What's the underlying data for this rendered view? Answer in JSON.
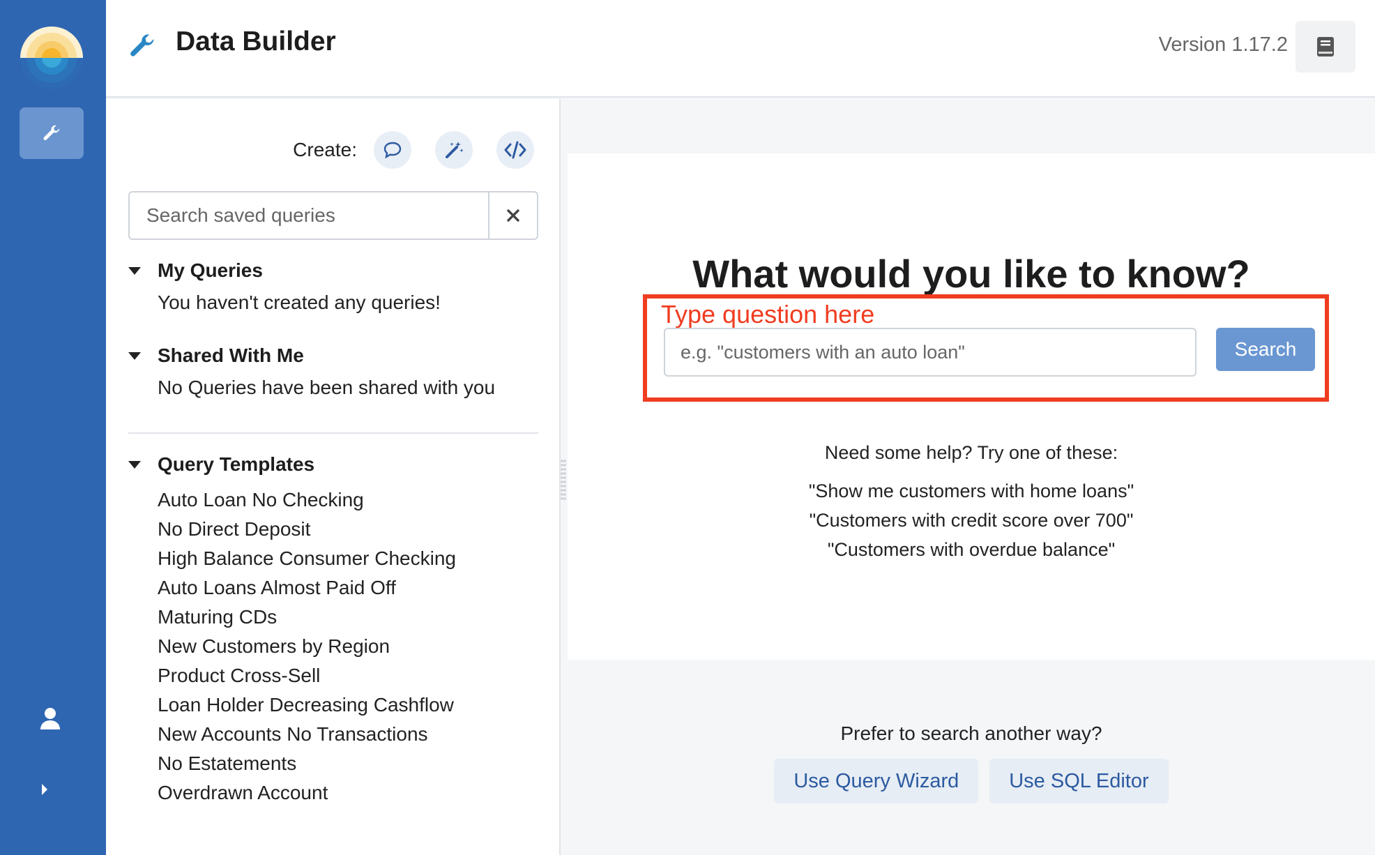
{
  "header": {
    "title": "Data Builder",
    "version": "Version 1.17.2"
  },
  "sidebar": {
    "create_label": "Create:",
    "search_placeholder": "Search saved queries",
    "my_queries": {
      "title": "My Queries",
      "empty": "You haven't created any queries!"
    },
    "shared": {
      "title": "Shared With Me",
      "empty": "No Queries have been shared with you"
    },
    "templates": {
      "title": "Query Templates",
      "items": [
        "Auto Loan No Checking",
        "No Direct Deposit",
        "High Balance Consumer Checking",
        "Auto Loans Almost Paid Off",
        "Maturing CDs",
        "New Customers by Region",
        "Product Cross-Sell",
        "Loan Holder Decreasing Cashflow",
        "New Accounts No Transactions",
        "No Estatements",
        "Overdrawn Account"
      ]
    }
  },
  "main": {
    "ask_title": "What would you like to know?",
    "type_hint": "Type question here",
    "question_placeholder": "e.g. \"customers with an auto loan\"",
    "search_label": "Search",
    "help_head": "Need some help? Try one of these:",
    "examples": [
      "\"Show me customers with home loans\"",
      "\"Customers with credit score over 700\"",
      "\"Customers with overdue balance\""
    ],
    "alt_head": "Prefer to search another way?",
    "wizard_label": "Use Query Wizard",
    "sql_label": "Use SQL Editor"
  },
  "colors": {
    "rail": "#2f66b2",
    "accent": "#6a97d2",
    "highlight": "#f03c20"
  }
}
